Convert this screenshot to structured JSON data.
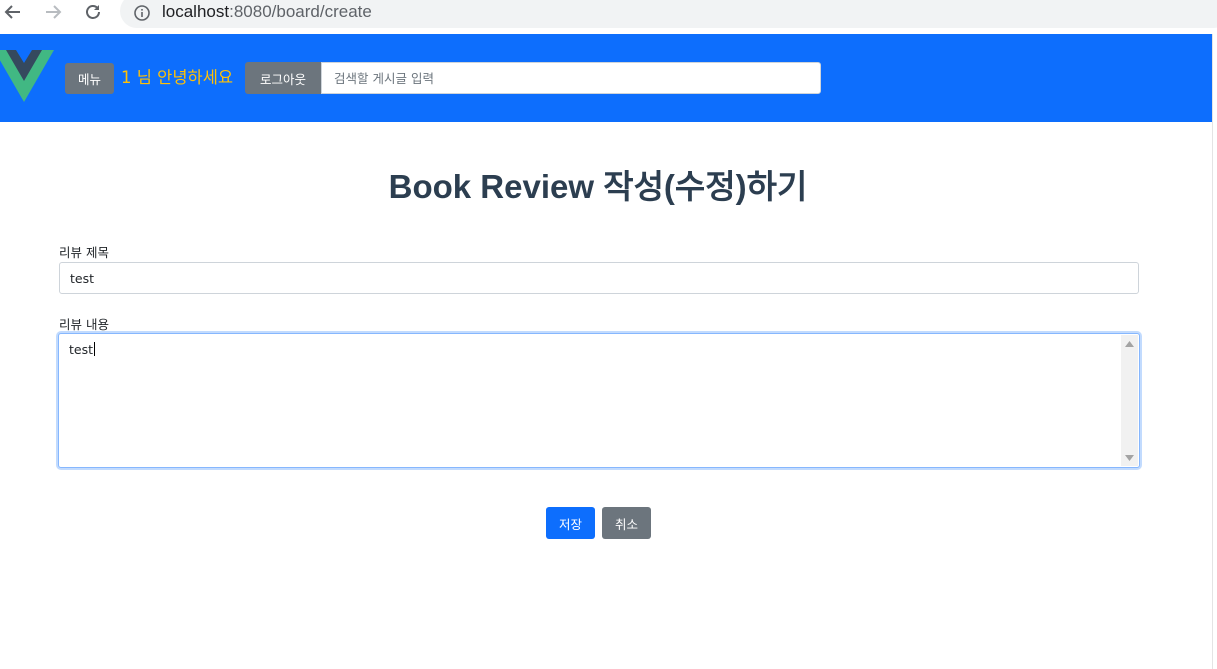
{
  "browser": {
    "url_host": "localhost",
    "url_rest": ":8080/board/create",
    "icons": [
      "back-arrow-icon",
      "forward-arrow-icon",
      "reload-icon",
      "info-icon"
    ]
  },
  "header": {
    "background_color": "#0d6efd",
    "menu_label": "메뉴",
    "greeting": "1 님 안녕하세요",
    "greeting_color": "#ffc107",
    "logout_label": "로그아웃",
    "search_placeholder": "검색할 게시글 입력",
    "logo_icon": "vue-logo-icon"
  },
  "form": {
    "page_title": "Book Review 작성(수정)하기",
    "title_label": "리뷰 제목",
    "title_value": "test",
    "content_label": "리뷰 내용",
    "content_value": "test",
    "save_label": "저장",
    "cancel_label": "취소"
  }
}
